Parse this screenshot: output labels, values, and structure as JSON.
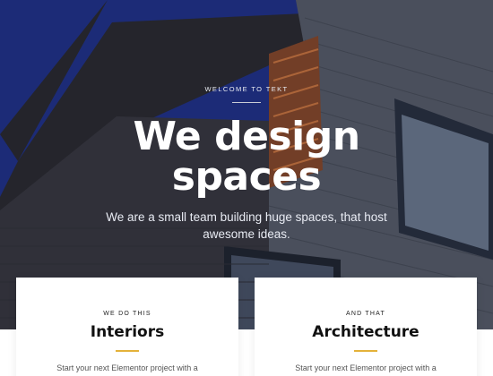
{
  "hero": {
    "eyebrow": "WELCOME TO TEKT",
    "headline_line1": "We design",
    "headline_line2": "spaces",
    "subtitle": "We are a small team building huge spaces, that host awesome ideas."
  },
  "cards": [
    {
      "label": "WE DO THIS",
      "title": "Interiors",
      "text": "Start your next Elementor project with a"
    },
    {
      "label": "AND THAT",
      "title": "Architecture",
      "text": "Start your next Elementor project with a"
    }
  ],
  "colors": {
    "sky": "#1f2d80",
    "accent": "#e4b23a",
    "text_dark": "#111111"
  }
}
